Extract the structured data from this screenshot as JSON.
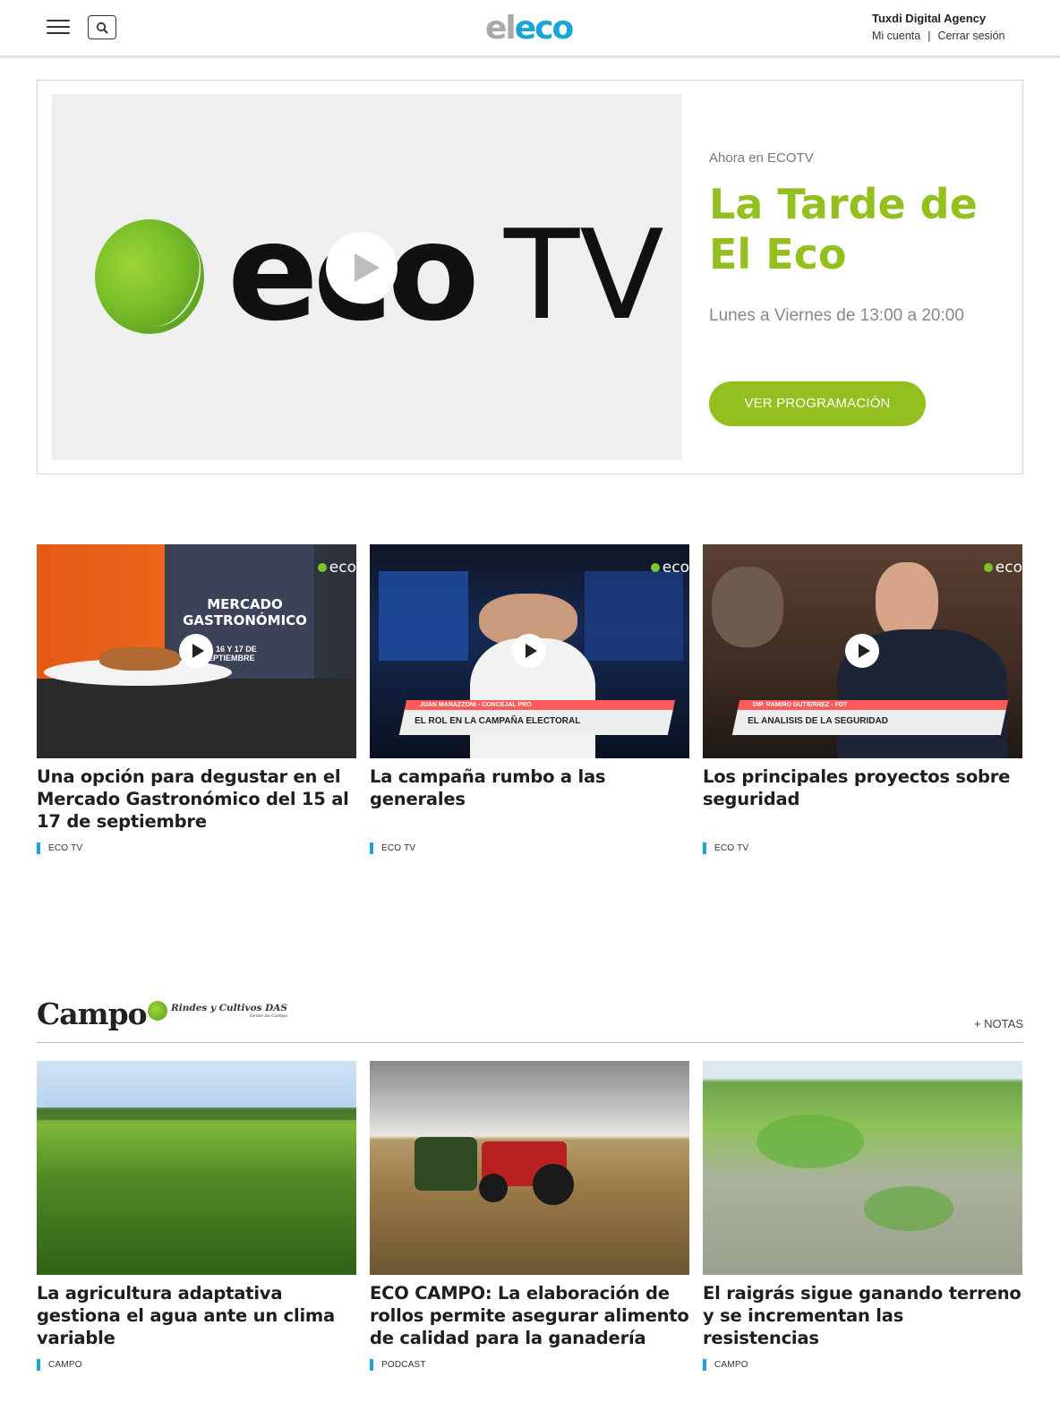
{
  "header": {
    "logo_el": "el",
    "logo_eco": "eco",
    "account_name": "Tuxdi Digital Agency",
    "my_account": "Mi cuenta",
    "separator": "|",
    "logout": "Cerrar sesión"
  },
  "live": {
    "brand_word": "eco",
    "brand_tv": "TV",
    "kicker": "Ahora en ECOTV",
    "title": "La Tarde de El Eco",
    "schedule": "Lunes a Viernes de 13:00 a 20:00",
    "button": "VER PROGRAMACIÓN"
  },
  "video_cards": [
    {
      "title": "Una opción para degustar en el Mercado Gastronómico del 15 al 17 de septiembre",
      "tag": "ECO TV",
      "thumb_caption": "MERCADO GASTRONÓMICO",
      "thumb_sub": "15, 16 Y 17 DE SEPTIEMBRE"
    },
    {
      "title": "La campaña rumbo a las generales",
      "tag": "ECO TV",
      "lower_third_name": "JUAN MANAZZONI - CONCEJAL PRO",
      "lower_third": "EL ROL EN LA CAMPAÑA ELECTORAL"
    },
    {
      "title": "Los principales proyectos sobre seguridad",
      "tag": "ECO TV",
      "lower_third_name": "DIP. RAMIRO GUTIERREZ - FDT",
      "lower_third": "EL ANALISIS DE LA SEGURIDAD"
    }
  ],
  "campo": {
    "section_title": "Campo",
    "sponsor": "Rindes y Cultivos DAS",
    "sponsor_sub": "Gente de Campo",
    "more": "+ NOTAS",
    "cards": [
      {
        "title": "La agricultura adaptativa gestiona el agua ante un clima variable",
        "tag": "CAMPO"
      },
      {
        "title": "ECO CAMPO: La elaboración de rollos permite asegurar alimento de calidad para la ganadería",
        "tag": "PODCAST"
      },
      {
        "title": "El raigrás sigue ganando terreno y se incrementan las resistencias",
        "tag": "CAMPO"
      }
    ]
  },
  "colors": {
    "accent_green": "#93c01f",
    "brand_blue": "#1aa5d8"
  }
}
